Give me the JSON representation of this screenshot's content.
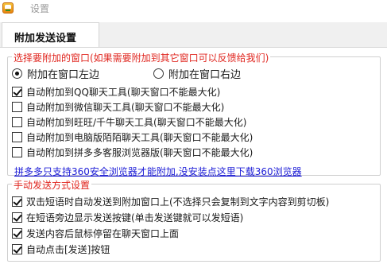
{
  "window": {
    "title": "设置"
  },
  "tabs": [
    {
      "label": "附加发送设置",
      "active": true
    }
  ],
  "attach_group": {
    "legend": "选择要附加的窗口(如果需要附加到其它窗口可以反馈给我们)",
    "radio_left": {
      "label": "附加在窗口左边",
      "checked": true
    },
    "radio_right": {
      "label": "附加在窗口右边",
      "checked": false
    },
    "options": [
      {
        "label": "自动附加到QQ聊天工具(聊天窗口不能最大化)",
        "checked": true
      },
      {
        "label": "自动附加到微信聊天工具(聊天窗口不能最大化)",
        "checked": false
      },
      {
        "label": "自动附加到旺旺/千牛聊天工具(聊天窗口不能最大化)",
        "checked": false
      },
      {
        "label": "自动附加到电脑版陌陌聊天工具(聊天窗口不能最大化)",
        "checked": false
      },
      {
        "label": "自动附加到拼多多客服浏览器版(聊天窗口不能最大化)",
        "checked": false
      }
    ],
    "link_text": "拼多多只支持360安全浏览器才能附加,没安装点这里下载360浏览器"
  },
  "manual_group": {
    "legend": "手动发送方式设置",
    "options": [
      {
        "label": "双击短语时自动发送到附加窗口上(不选择只会复制到文字内容到剪切板)",
        "checked": true
      },
      {
        "label": "在短语旁边显示发送按键(单击发送键就可以发短语)",
        "checked": true
      },
      {
        "label": "发送内容后鼠标停留在聊天窗口上面",
        "checked": true
      },
      {
        "label": "自动点击[发送]按钮",
        "checked": true
      }
    ]
  },
  "colors": {
    "legend": "#e0261f",
    "link": "#1b1bd6"
  }
}
